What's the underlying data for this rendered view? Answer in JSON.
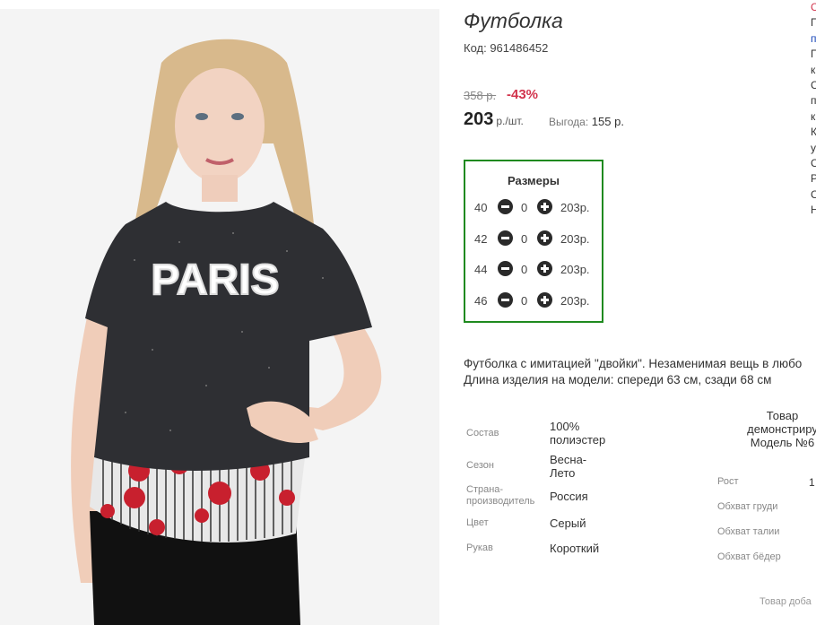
{
  "product": {
    "title": "Футболка",
    "sku": "Код: 961486452",
    "old_price": "358 р.",
    "discount": "-43%",
    "price": "203",
    "price_unit": "р./шт.",
    "savings_label": "Выгода:",
    "savings_value": "155 р."
  },
  "sizes": {
    "title": "Размеры",
    "items": [
      {
        "size": "40",
        "qty": "0",
        "price": "203р."
      },
      {
        "size": "42",
        "qty": "0",
        "price": "203р."
      },
      {
        "size": "44",
        "qty": "0",
        "price": "203р."
      },
      {
        "size": "46",
        "qty": "0",
        "price": "203р."
      }
    ]
  },
  "description": {
    "line1": "Футболка с имитацией \"двойки\". Незаменимая вещь в любо",
    "line2": "Длина изделия на модели: спереди 63 см, сзади 68 см"
  },
  "properties": [
    {
      "label": "Состав",
      "value": "100% полиэстер"
    },
    {
      "label": "Сезон",
      "value": "Весна-Лето"
    },
    {
      "label": "Страна-производитель",
      "value": "Россия"
    },
    {
      "label": "Цвет",
      "value": "Серый"
    },
    {
      "label": "Рукав",
      "value": "Короткий"
    }
  ],
  "model": {
    "head_line1": "Товар",
    "head_line2": "демонстриру",
    "head_line3": "Модель №6",
    "rows": [
      {
        "label": "Рост",
        "value": "1"
      },
      {
        "label": "Обхват груди",
        "value": ""
      },
      {
        "label": "Обхват талии",
        "value": ""
      },
      {
        "label": "Обхват бёдер",
        "value": ""
      }
    ],
    "footer": "Товар доба"
  },
  "image": {
    "print_text": "PARIS"
  },
  "colors": {
    "accent_red": "#d2344d",
    "sizes_border": "#1f8a1f",
    "link_blue": "#1a47b8"
  },
  "sidebar_fragments": [
    "С",
    "П",
    "п",
    "П",
    "к",
    "С",
    "п",
    "к",
    "К",
    "у",
    "С",
    "Р",
    "С",
    "Н"
  ]
}
